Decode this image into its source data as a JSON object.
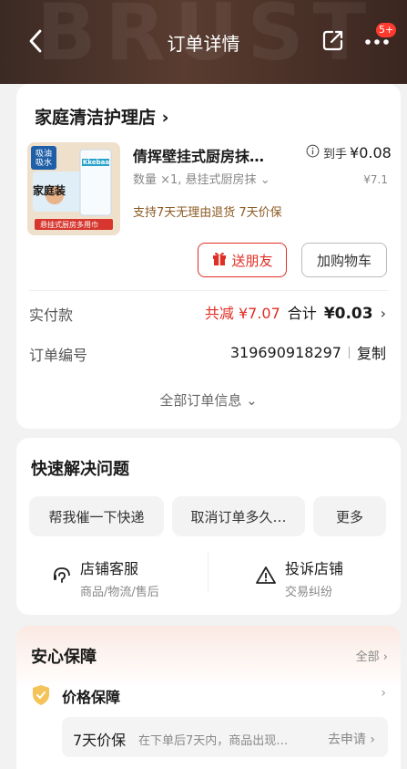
{
  "header": {
    "title": "订单详情",
    "badge": "5+",
    "background_text": "BRUST"
  },
  "order": {
    "shop_name": "家庭清洁护理店 ›",
    "product": {
      "name": "倩挥壁挂式厨房抹…",
      "spec": "数量 ×1, 悬挂式厨房抹 ⌄",
      "hand_price_label": "到手",
      "hand_price": "¥0.08",
      "original_price": "¥7.1",
      "service_tags": "支持7天无理由退货   7天价保",
      "image": {
        "tag1": "吸油吸水",
        "brand": "Kkebaa",
        "label": "家庭装",
        "caption": "悬挂式厨房多用巾"
      }
    },
    "gift_button": "送朋友",
    "cart_button": "加购物车",
    "paid_label": "实付款",
    "reduce_text": "共减 ¥7.07",
    "total_label": "合计",
    "total_value": "¥0.03",
    "order_no_label": "订单编号",
    "order_no": "319690918297",
    "copy_label": "复制",
    "all_info": "全部订单信息 ⌄"
  },
  "quick": {
    "title": "快速解决问题",
    "chips": [
      "帮我催一下快递",
      "取消订单多久…",
      "更多"
    ],
    "services": [
      {
        "title": "店铺客服",
        "sub": "商品/物流/售后"
      },
      {
        "title": "投诉店铺",
        "sub": "交易纠纷"
      }
    ]
  },
  "guarantee": {
    "title": "安心保障",
    "all_label": "全部 ›",
    "price_title": "价格保障",
    "detail_title": "7天价保",
    "detail_desc": "在下单后7天内，商品出现…",
    "detail_action": "去申请 ›"
  },
  "colors": {
    "accent_red": "#e02e24",
    "service_brown": "#8b5a22",
    "header_bg": "#4a3228"
  }
}
